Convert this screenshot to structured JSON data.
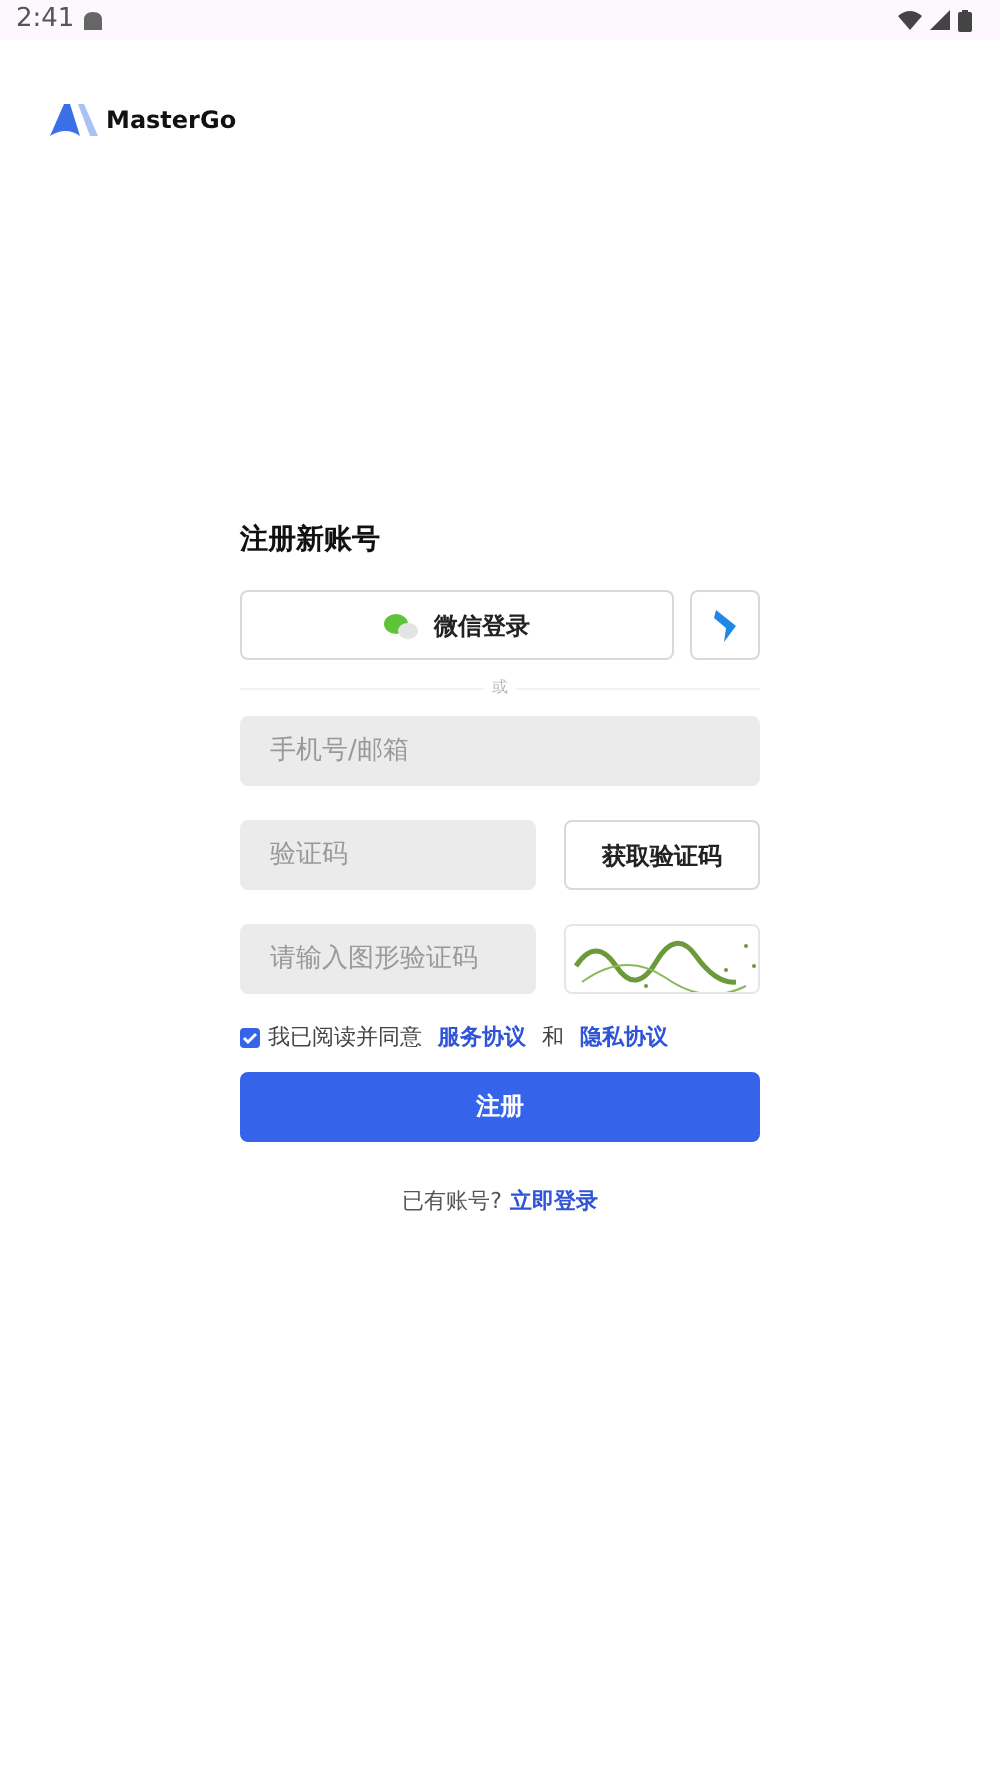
{
  "status_bar": {
    "time": "2:41"
  },
  "logo": {
    "text": "MasterGo"
  },
  "form": {
    "title": "注册新账号",
    "wechat_button": "微信登录",
    "divider": "或",
    "fields": [
      {
        "kind": "plain",
        "placeholder": "手机号/邮箱"
      },
      {
        "kind": "code",
        "placeholder": "验证码",
        "button": "获取验证码"
      },
      {
        "kind": "captcha",
        "placeholder": "请输入图形验证码"
      }
    ],
    "agree": {
      "checked": true,
      "text": "我已阅读并同意",
      "link1": "服务协议",
      "and": "和",
      "link2": "隐私协议"
    },
    "submit": "注册",
    "footer": {
      "text": "已有账号?",
      "link": "立即登录"
    }
  }
}
